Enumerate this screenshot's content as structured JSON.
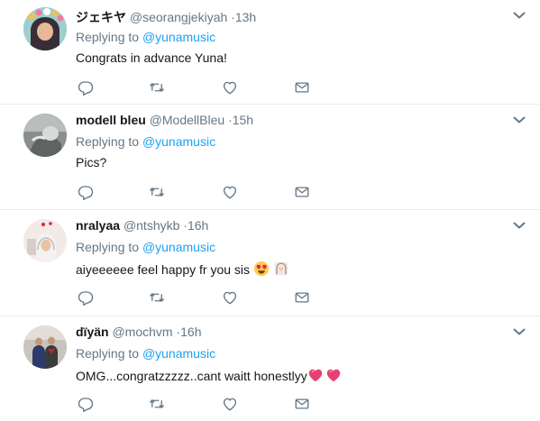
{
  "replies": [
    {
      "name": "ジェキヤ",
      "handle": "@seorangjekiyah",
      "time": "·13h",
      "replying_prefix": "Replying to",
      "replying_handle": "@yunamusic",
      "text": "Congrats in advance Yuna!",
      "emojis": []
    },
    {
      "name": "modell bleu",
      "handle": "@ModellBleu",
      "time": "·15h",
      "replying_prefix": "Replying to",
      "replying_handle": "@yunamusic",
      "text": "Pics?",
      "emojis": []
    },
    {
      "name": "nralyaa",
      "handle": "@ntshykb",
      "time": "·16h",
      "replying_prefix": "Replying to",
      "replying_handle": "@yunamusic",
      "text": "aiyeeeeee feel happy fr you sis",
      "emojis": [
        "heart-eyes-emoji",
        "woman-face-emoji"
      ]
    },
    {
      "name": "dïyän",
      "handle": "@mochvm",
      "time": "·16h",
      "replying_prefix": "Replying to",
      "replying_handle": "@yunamusic",
      "text": "OMG...congratzzzzz..cant waitt honestlyy",
      "emojis": [
        "heart-emoji",
        "heart-emoji"
      ]
    }
  ],
  "icons": {
    "reply": "reply-icon",
    "retweet": "retweet-icon",
    "like": "heart-icon",
    "message": "envelope-icon",
    "more": "chevron-down-icon"
  },
  "colors": {
    "text": "#14171a",
    "muted": "#657786",
    "link": "#1da1f2",
    "divider": "#e6ecf0"
  }
}
